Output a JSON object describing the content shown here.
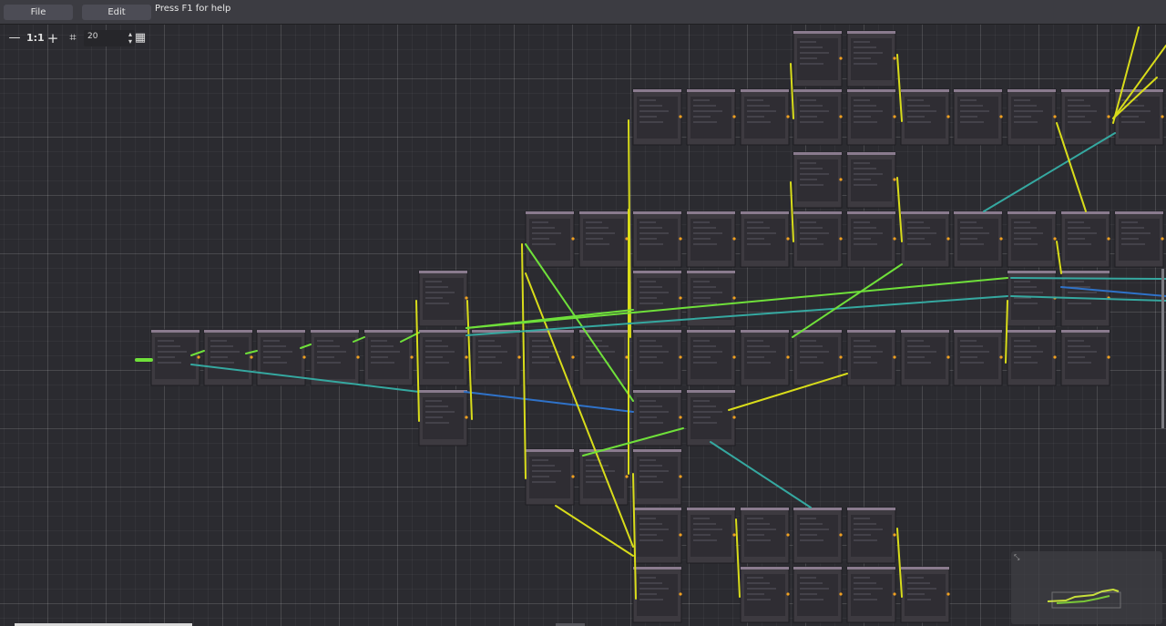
{
  "menubar": {
    "file_label": "File",
    "edit_label": "Edit",
    "help_text": "Press F1 for help"
  },
  "toolbar": {
    "zoom_out_icon": "minus-icon",
    "zoom_out_label": "—",
    "zoom_reset_icon": "zoom-reset-icon",
    "zoom_reset_label": "1:1",
    "zoom_in_icon": "plus-icon",
    "zoom_in_label": "+",
    "snap_icon": "grid-snap-icon",
    "snap_label": "⌗",
    "snap_value": "20",
    "minimap_icon": "minimap-icon",
    "minimap_label": "▦"
  },
  "colors": {
    "canvas_bg": "#2b2b30",
    "node_body": "#3d3a40",
    "node_header": "#8a7b8e",
    "wire_yellow": "#d8dc1a",
    "wire_green": "#6fe03a",
    "wire_teal": "#35a8a0",
    "wire_blue": "#2f72c8",
    "port_orange": "#f0a020"
  }
}
